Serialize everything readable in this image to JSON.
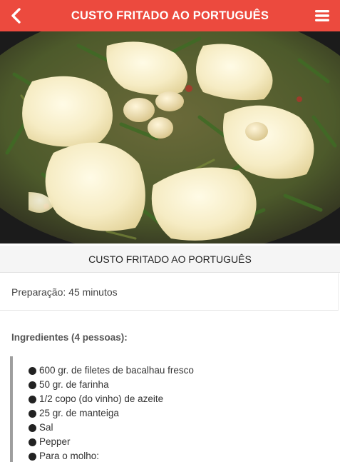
{
  "appbar": {
    "title": "CUSTO FRITADO AO PORTUGUÊS",
    "back_icon": "chevron-left-icon",
    "menu_icon": "hamburger-menu-icon",
    "color": "#ec4a3e"
  },
  "recipe": {
    "title": "CUSTO FRITADO AO PORTUGUÊS",
    "preparation": "Preparação: 45 minutos",
    "ingredients_heading": "Ingredientes (4 pessoas):",
    "ingredients": [
      "600 gr. de filetes de bacalhau fresco",
      "50 gr. de farinha",
      "1/2 copo (do vinho) de azeite",
      "25 gr. de manteiga",
      "Sal",
      "Pepper",
      "Para o molho:"
    ]
  }
}
